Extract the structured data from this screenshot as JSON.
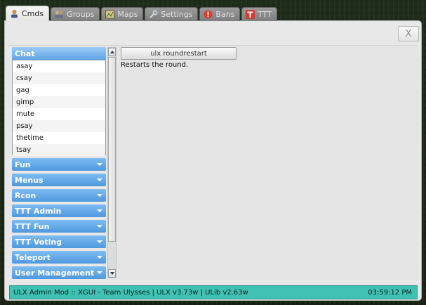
{
  "tabs": [
    {
      "label": "Cmds",
      "icon": "user-icon",
      "active": true
    },
    {
      "label": "Groups",
      "icon": "users-icon",
      "active": false
    },
    {
      "label": "Maps",
      "icon": "map-icon",
      "active": false
    },
    {
      "label": "Settings",
      "icon": "wrench-icon",
      "active": false
    },
    {
      "label": "Bans",
      "icon": "ban-icon",
      "active": false
    },
    {
      "label": "TTT",
      "icon": "ttt-icon",
      "active": false
    }
  ],
  "close_label": "X",
  "categories": {
    "open": {
      "label": "Chat",
      "commands": [
        "asay",
        "csay",
        "gag",
        "gimp",
        "mute",
        "psay",
        "thetime",
        "tsay"
      ]
    },
    "collapsed": [
      "Fun",
      "Menus",
      "Rcon",
      "TTT Admin",
      "TTT Fun",
      "TTT Voting",
      "Teleport",
      "User Management"
    ]
  },
  "command_panel": {
    "button_label": "ulx roundrestart",
    "description": "Restarts the round."
  },
  "status_bar": {
    "left": "ULX Admin Mod :: XGUI - Team Ulysses |  ULX v3.73w  |  ULib v2.63w",
    "right": "03:59:12 PM"
  },
  "colors": {
    "accent_blue": "#5fa5e6",
    "status_teal": "#3fc2b4",
    "ban_red": "#d83a2e",
    "ttt_red": "#d23b2f"
  }
}
